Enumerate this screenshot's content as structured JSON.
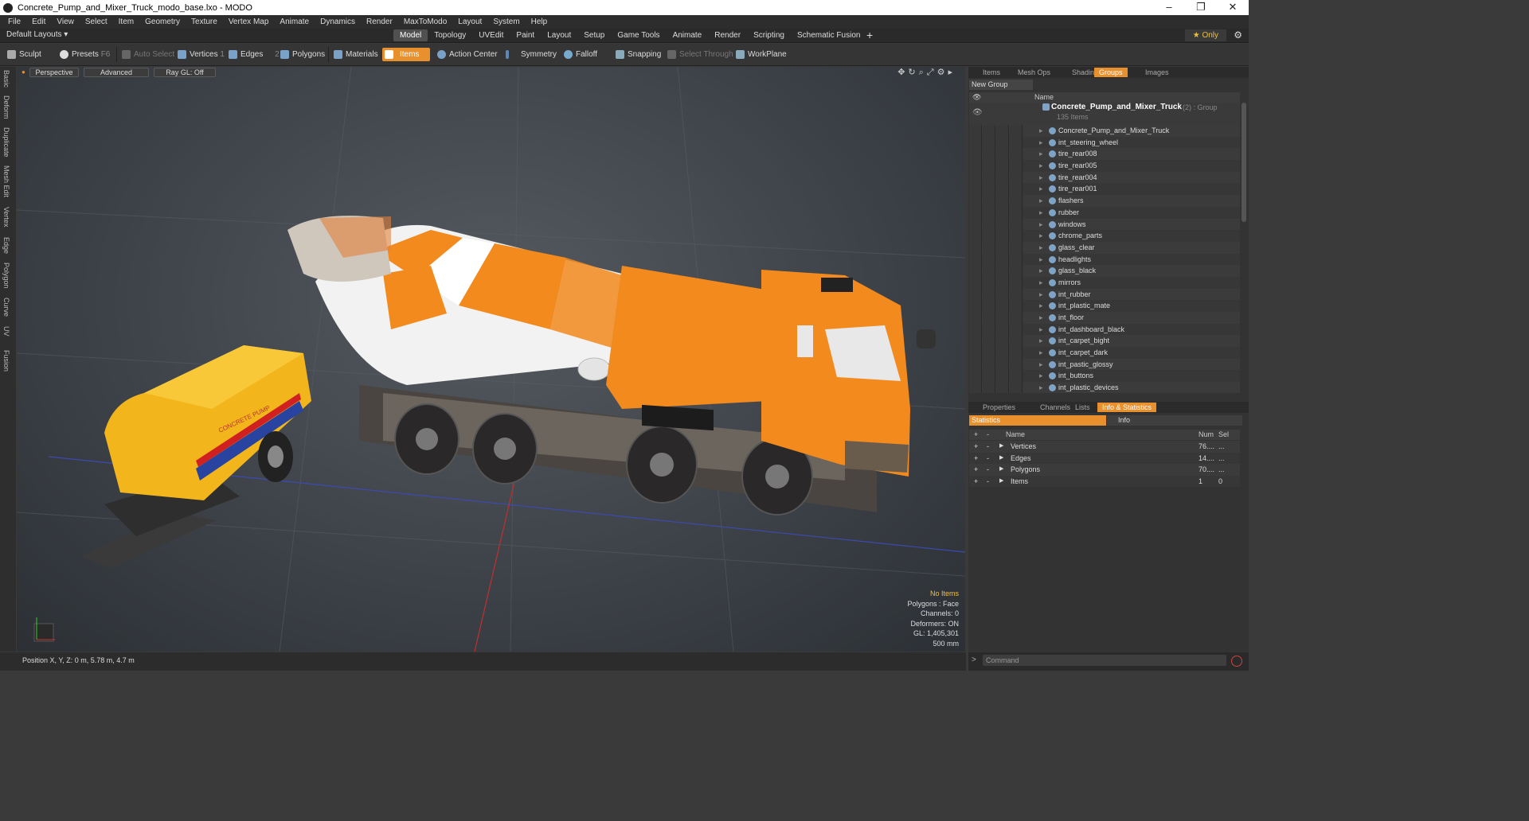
{
  "window": {
    "title": "Concrete_Pump_and_Mixer_Truck_modo_base.lxo - MODO"
  },
  "menu": [
    "File",
    "Edit",
    "View",
    "Select",
    "Item",
    "Geometry",
    "Texture",
    "Vertex Map",
    "Animate",
    "Dynamics",
    "Render",
    "MaxToModo",
    "Layout",
    "System",
    "Help"
  ],
  "layout": {
    "name": "Default Layouts",
    "only": "Only"
  },
  "tabs": [
    "Model",
    "Topology",
    "UVEdit",
    "Paint",
    "Layout",
    "Setup",
    "Game Tools",
    "Animate",
    "Render",
    "Scripting",
    "Schematic Fusion"
  ],
  "toolbar": {
    "sculpt": "Sculpt",
    "presets": "Presets",
    "presets_key": "F6",
    "auto_select": "Auto Select",
    "vertices": "Vertices",
    "vertices_count": "1",
    "edges": "Edges",
    "edges_count": "2",
    "polygons": "Polygons",
    "materials": "Materials",
    "items": "Items",
    "action_center": "Action Center",
    "symmetry": "Symmetry",
    "falloff": "Falloff",
    "snapping": "Snapping",
    "select_through": "Select Through",
    "workplane": "WorkPlane"
  },
  "left_tabs": [
    "Basic",
    "Deform",
    "Duplicate",
    "Mesh Edit",
    "Vertex",
    "Edge",
    "Polygon",
    "Curve",
    "UV",
    "Fusion"
  ],
  "viewport": {
    "perspective": "Perspective",
    "advanced": "Advanced",
    "raygl": "Ray GL: Off",
    "info": {
      "no_items": "No Items",
      "polygons": "Polygons : Face",
      "channels": "Channels: 0",
      "deformers": "Deformers: ON",
      "gl": "GL: 1,405,301",
      "scale": "500 mm"
    },
    "truck_label": "CONCRETE PUMP"
  },
  "status": {
    "position": "Position X, Y, Z:  0 m, 5.78 m, 4.7 m"
  },
  "top_panel": {
    "tabs": [
      "Items",
      "Mesh Ops",
      "Shading",
      "Groups",
      "Images"
    ],
    "new_group": "New Group",
    "name_header": "Name",
    "group_name": "Concrete_Pump_and_Mixer_Truck",
    "group_suffix": "(2) : Group",
    "group_count": "135 Items",
    "items": [
      "Concrete_Pump_and_Mixer_Truck",
      "int_steering_wheel",
      "tire_rear008",
      "tire_rear005",
      "tire_rear004",
      "tire_rear001",
      "flashers",
      "rubber",
      "windows",
      "chrome_parts",
      "glass_clear",
      "headlights",
      "glass_black",
      "mirrors",
      "int_rubber",
      "int_plastic_mate",
      "int_floor",
      "int_dashboard_black",
      "int_carpet_bight",
      "int_carpet_dark",
      "int_pastic_glossy",
      "int_buttons",
      "int_plastic_devices"
    ]
  },
  "bottom_panel": {
    "tabs": [
      "Properties",
      "Channels",
      "Lists",
      "Info & Statistics"
    ],
    "statistics": "Statistics",
    "info": "Info",
    "headers": {
      "name": "Name",
      "num": "Num",
      "sel": "Sel"
    },
    "rows": [
      {
        "name": "Vertices",
        "num": "76....",
        "sel": "..."
      },
      {
        "name": "Edges",
        "num": "14....",
        "sel": "..."
      },
      {
        "name": "Polygons",
        "num": "70....",
        "sel": "..."
      },
      {
        "name": "Items",
        "num": "1",
        "sel": "0"
      }
    ]
  },
  "command": {
    "placeholder": "Command"
  },
  "colors": {
    "accent": "#e8902e",
    "truck_orange": "#f28a1e",
    "pump_yellow": "#f2b51c"
  }
}
